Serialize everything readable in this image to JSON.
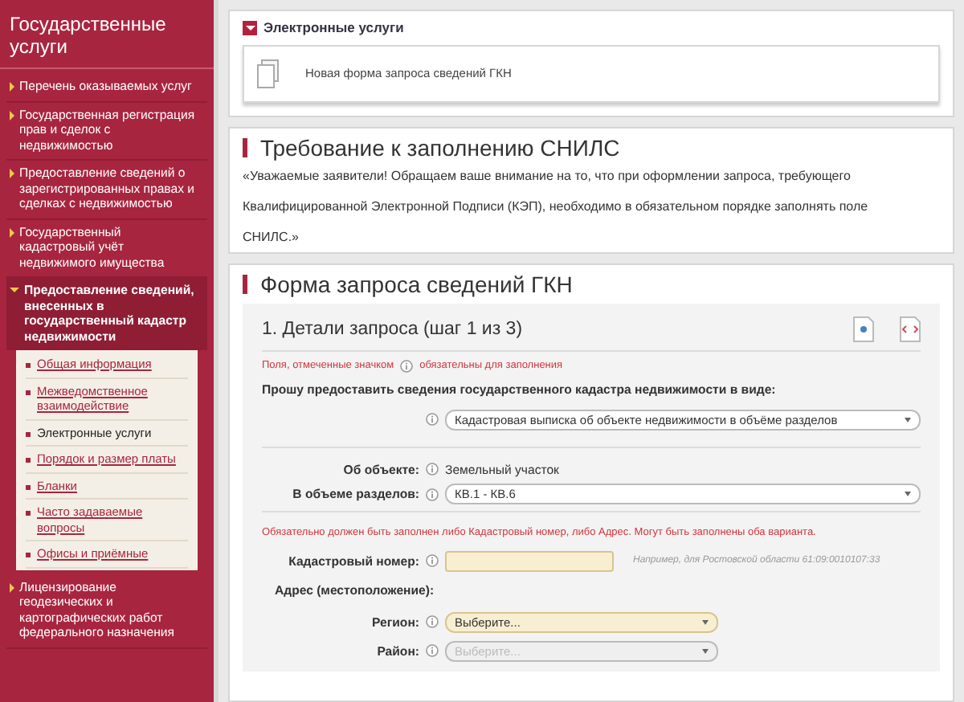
{
  "sidebar": {
    "title": "Государственные услуги",
    "items": [
      {
        "label": "Перечень оказываемых услуг",
        "expanded": false
      },
      {
        "label": "Государственная регистрация прав и сделок с недвижимостью",
        "expanded": false
      },
      {
        "label": "Предоставление сведений о зарегистрированных правах и сделках с недвижимостью",
        "expanded": false
      },
      {
        "label": "Государственный кадастровый учёт недвижимого имущества",
        "expanded": false
      },
      {
        "label": "Предоставление сведений, внесенных в государственный кадастр недвижимости",
        "expanded": true,
        "children": [
          {
            "label": "Общая информация",
            "selected": false
          },
          {
            "label": "Межведомственное взаимодействие",
            "selected": false
          },
          {
            "label": "Электронные услуги",
            "selected": true
          },
          {
            "label": "Порядок и размер платы",
            "selected": false
          },
          {
            "label": "Бланки",
            "selected": false
          },
          {
            "label": "Часто задаваемые вопросы",
            "selected": false
          },
          {
            "label": "Офисы и приёмные",
            "selected": false
          }
        ]
      },
      {
        "label": "Лицензирование геодезических и картографических работ федерального назначения",
        "expanded": false
      }
    ]
  },
  "services": {
    "title": "Электронные услуги",
    "expanded": true,
    "items": [
      "Новая форма запроса сведений ГКН"
    ]
  },
  "notice": {
    "title": "Требование к заполнению СНИЛС",
    "text": "«Уважаемые заявители! Обращаем ваше внимание на то, что при оформлении запроса, требующего Квалифицированной Электронной Подписи (КЭП), необходимо в обязательном порядке заполнять поле СНИЛС.»"
  },
  "form": {
    "title": "Форма запроса сведений ГКН",
    "step_title": "1. Детали запроса (шаг 1 из 3)",
    "required_note": [
      "Поля, отмеченные значком",
      "обязательны для заполнения"
    ],
    "legend": "Прошу предоставить сведения государственного кадастра недвижимости в виде:",
    "rows": [
      {
        "kind": "select",
        "label": "",
        "value": "Кадастровая выписка об объекте недвижимости в объёме разделов",
        "required": false,
        "disabled": false,
        "wide": true
      },
      {
        "kind": "static",
        "label": "Об объекте:",
        "value": "Земельный участок"
      },
      {
        "kind": "select",
        "label": "В объеме разделов:",
        "value": "КВ.1 - КВ.6",
        "required": false,
        "disabled": false,
        "wide": true
      },
      {
        "kind": "warning",
        "text": "Обязательно должен быть заполнен либо Кадастровый номер, либо Адрес. Могут быть заполнены оба варианта."
      },
      {
        "kind": "input",
        "label": "Кадастровый номер:",
        "value": "",
        "hint": "Например, для Ростовской области 61:09:0010107:33",
        "required": true,
        "disabled": false
      },
      {
        "kind": "heading",
        "text": "Адрес (местоположение):"
      },
      {
        "kind": "select",
        "label": "Регион:",
        "value": "Выберите...",
        "required": true,
        "disabled": false,
        "wide": false
      },
      {
        "kind": "select",
        "label": "Район:",
        "value": "Выберите...",
        "required": false,
        "disabled": true,
        "wide": false
      }
    ]
  }
}
